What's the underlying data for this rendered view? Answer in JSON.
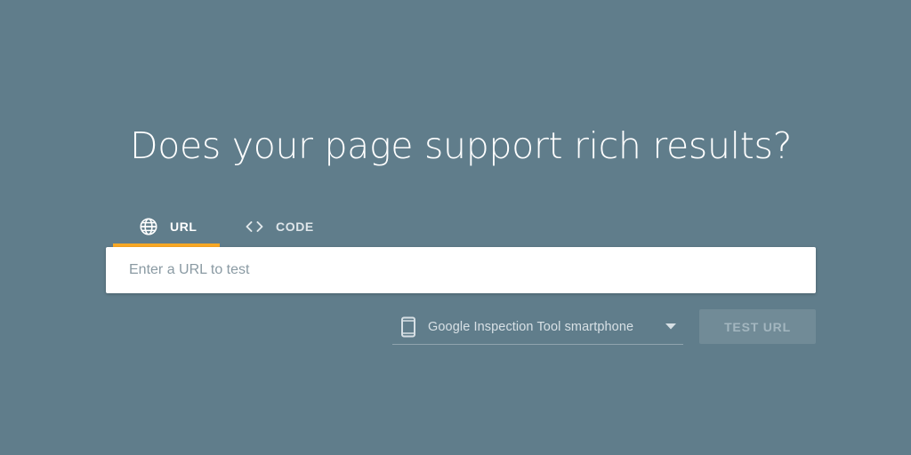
{
  "headline": "Does your page support rich results?",
  "tabs": [
    {
      "label": "URL",
      "icon": "globe-icon",
      "selected": true
    },
    {
      "label": "CODE",
      "icon": "code-brackets-icon",
      "selected": false
    }
  ],
  "url_input": {
    "placeholder": "Enter a URL to test",
    "value": ""
  },
  "device_select": {
    "icon": "smartphone-icon",
    "selected": "Google Inspection Tool smartphone"
  },
  "test_button": {
    "label": "TEST URL",
    "enabled": false
  },
  "colors": {
    "background": "#607d8b",
    "tab_indicator": "#f9a825",
    "input_background": "#ffffff",
    "button_background": "#718b97"
  }
}
